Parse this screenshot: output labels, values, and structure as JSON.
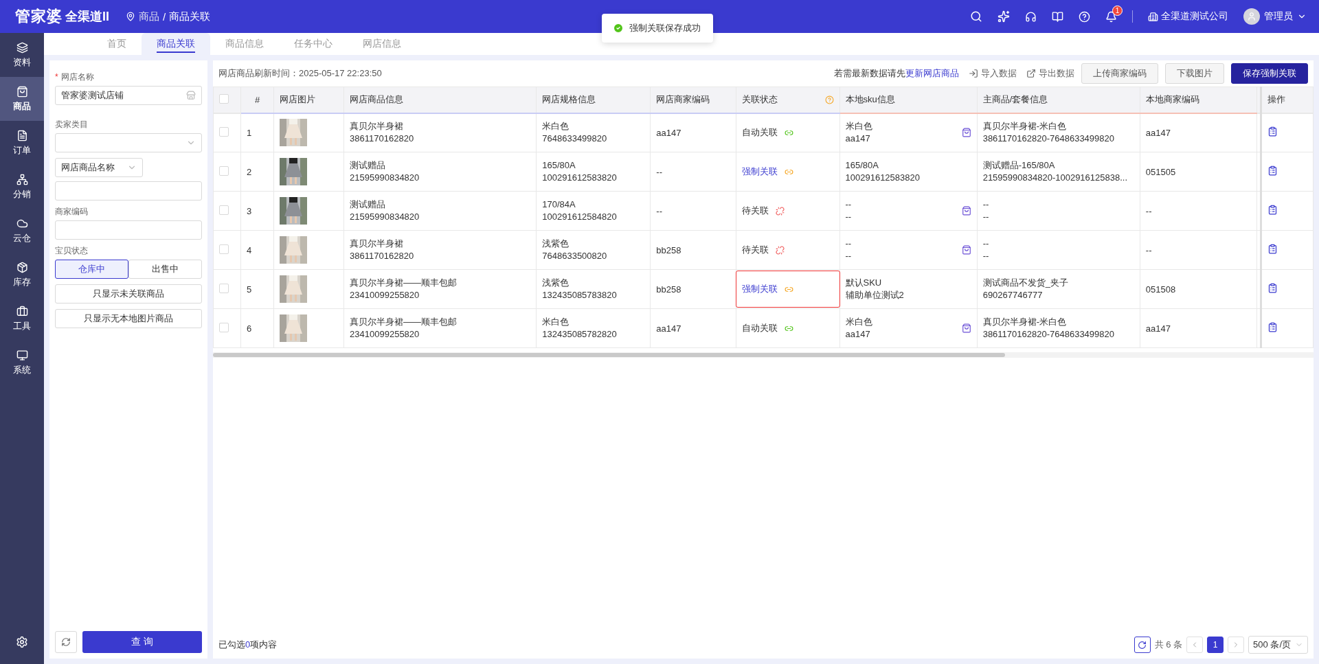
{
  "header": {
    "logo_main": "管家婆",
    "logo_sub": "全渠道II",
    "breadcrumb": {
      "items": [
        "商品",
        "商品关联"
      ],
      "separator": "/"
    },
    "notification_count": "1",
    "company": "全渠道测试公司",
    "user": "管理员"
  },
  "toast": {
    "message": "强制关联保存成功"
  },
  "nav": [
    {
      "label": "资料",
      "selected": false
    },
    {
      "label": "商品",
      "selected": true
    },
    {
      "label": "订单",
      "selected": false
    },
    {
      "label": "分销",
      "selected": false
    },
    {
      "label": "云仓",
      "selected": false
    },
    {
      "label": "库存",
      "selected": false
    },
    {
      "label": "工具",
      "selected": false
    },
    {
      "label": "系统",
      "selected": false
    }
  ],
  "tabs": [
    {
      "label": "首页",
      "selected": false
    },
    {
      "label": "商品关联",
      "selected": true
    },
    {
      "label": "商品信息",
      "selected": false
    },
    {
      "label": "任务中心",
      "selected": false
    },
    {
      "label": "网店信息",
      "selected": false
    }
  ],
  "filters": {
    "store": {
      "label": "网店名称",
      "required_mark": "*",
      "value": "管家婆测试店铺"
    },
    "category": {
      "label": "卖家类目"
    },
    "name_field": {
      "option": "网店商品名称"
    },
    "code": {
      "label": "商家编码"
    },
    "status": {
      "label": "宝贝状态",
      "options": [
        {
          "label": "仓库中",
          "selected": true
        },
        {
          "label": "出售中",
          "selected": false
        }
      ]
    },
    "toggles": [
      "只显示未关联商品",
      "只显示无本地图片商品"
    ],
    "query": "查 询"
  },
  "toolbar": {
    "refresh_label": "网店商品刷新时间：",
    "refresh_time": "2025-05-17 22:23:50",
    "hint": "若需最新数据请先",
    "hint_link": "更新网店商品",
    "import": "导入数据",
    "export": "导出数据",
    "buttons": [
      {
        "label": "上传商家编码",
        "primary": false
      },
      {
        "label": "下载图片",
        "primary": false
      },
      {
        "label": "保存强制关联",
        "primary": true
      }
    ]
  },
  "table": {
    "header_checked": false,
    "columns": [
      "#",
      "网店图片",
      "网店商品信息",
      "网店规格信息",
      "网店商家编码",
      "关联状态",
      "本地sku信息",
      "主商品/套餐信息",
      "本地商家编码",
      "操作"
    ],
    "rows": [
      {
        "checked": false,
        "index": "1",
        "image": {
          "kind": "picture"
        },
        "name": "真贝尔半身裙",
        "id": "3861170162820",
        "spec": "米白色",
        "spec_id": "7648633499820",
        "code": "aa147",
        "status": {
          "kind": "auto",
          "label": "自动关联"
        },
        "highlighted": false,
        "sku": [
          "米白色",
          "aa147"
        ],
        "sku_picker": true,
        "main": [
          "真贝尔半身裙-米白色",
          "3861170162820-7648633499820"
        ],
        "local_code": "aa147"
      },
      {
        "checked": false,
        "index": "2",
        "image": {
          "kind": "picture"
        },
        "name": "测试赠品",
        "id": "21595990834820",
        "spec": "165/80A",
        "spec_id": "100291612583820",
        "code": "--",
        "status": {
          "kind": "forced",
          "label": "强制关联"
        },
        "highlighted": false,
        "sku": [
          "165/80A",
          "100291612583820"
        ],
        "sku_picker": false,
        "main": [
          "测试赠品-165/80A",
          "21595990834820-1002916125838..."
        ],
        "local_code": "051505"
      },
      {
        "checked": false,
        "index": "3",
        "image": {
          "kind": "picture"
        },
        "name": "测试赠品",
        "id": "21595990834820",
        "spec": "170/84A",
        "spec_id": "100291612584820",
        "code": "--",
        "status": {
          "kind": "pending",
          "label": "待关联"
        },
        "highlighted": false,
        "sku": [
          "--",
          "--"
        ],
        "sku_picker": true,
        "main": [
          "--",
          "--"
        ],
        "local_code": "--"
      },
      {
        "checked": false,
        "index": "4",
        "image": {
          "kind": "picture"
        },
        "name": "真贝尔半身裙",
        "id": "3861170162820",
        "spec": "浅紫色",
        "spec_id": "7648633500820",
        "code": "bb258",
        "status": {
          "kind": "pending",
          "label": "待关联"
        },
        "highlighted": false,
        "sku": [
          "--",
          "--"
        ],
        "sku_picker": true,
        "main": [
          "--",
          "--"
        ],
        "local_code": "--"
      },
      {
        "checked": false,
        "index": "5",
        "image": {
          "kind": "picture"
        },
        "name": "真贝尔半身裙——顺丰包邮",
        "id": "23410099255820",
        "spec": "浅紫色",
        "spec_id": "132435085783820",
        "code": "bb258",
        "status": {
          "kind": "forced",
          "label": "强制关联"
        },
        "highlighted": true,
        "sku": [
          "默认SKU",
          "辅助单位测试2"
        ],
        "sku_picker": false,
        "main": [
          "测试商品不发货_夹子",
          "690267746777"
        ],
        "local_code": "051508"
      },
      {
        "checked": false,
        "index": "6",
        "image": {
          "kind": "picture"
        },
        "name": "真贝尔半身裙——顺丰包邮",
        "id": "23410099255820",
        "spec": "米白色",
        "spec_id": "132435085782820",
        "code": "aa147",
        "status": {
          "kind": "auto",
          "label": "自动关联"
        },
        "highlighted": false,
        "sku": [
          "米白色",
          "aa147"
        ],
        "sku_picker": true,
        "main": [
          "真贝尔半身裙-米白色",
          "3861170162820-7648633499820"
        ],
        "local_code": "aa147"
      }
    ]
  },
  "footer": {
    "selected_prefix": "已勾选",
    "selected_count": "0",
    "selected_suffix": "项内容",
    "total": "共 6 条",
    "pages": [
      {
        "label": "1",
        "selected": true
      }
    ],
    "page_size": "500 条/页"
  }
}
